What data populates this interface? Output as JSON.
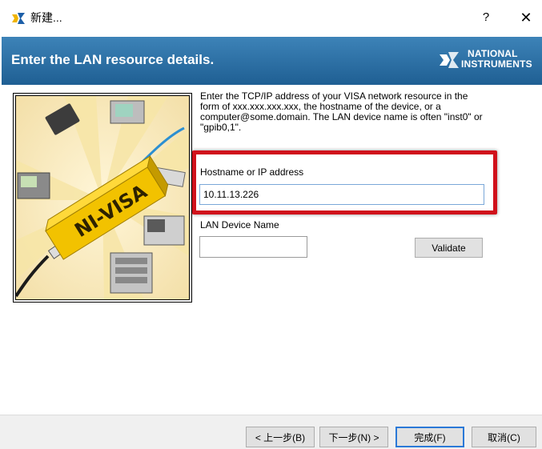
{
  "window": {
    "title": "新建...",
    "help_label": "?",
    "close_label": "✕"
  },
  "banner": {
    "title": "Enter the LAN resource details.",
    "logo_line1": "NATIONAL",
    "logo_line2": "INSTRUMENTS"
  },
  "illustration": {
    "product_text": "NI-VISA"
  },
  "form": {
    "description": "Enter the TCP/IP address of your VISA network resource in the form of xxx.xxx.xxx.xxx, the hostname of the device, or a computer@some.domain. The LAN device name is often \"inst0\" or \"gpib0,1\".",
    "hostname_label": "Hostname or IP address",
    "hostname_value": "10.11.13.226",
    "lan_device_label": "LAN Device Name",
    "lan_device_value": "",
    "validate_label": "Validate"
  },
  "footer": {
    "back_label": "< 上一步(B)",
    "next_label": "下一步(N) >",
    "finish_label": "完成(F)",
    "cancel_label": "取消(C)"
  },
  "colors": {
    "banner_top": "#3d83b8",
    "banner_bottom": "#1f5f93",
    "highlight": "#d0111b",
    "focus_border": "#2b79d7"
  }
}
